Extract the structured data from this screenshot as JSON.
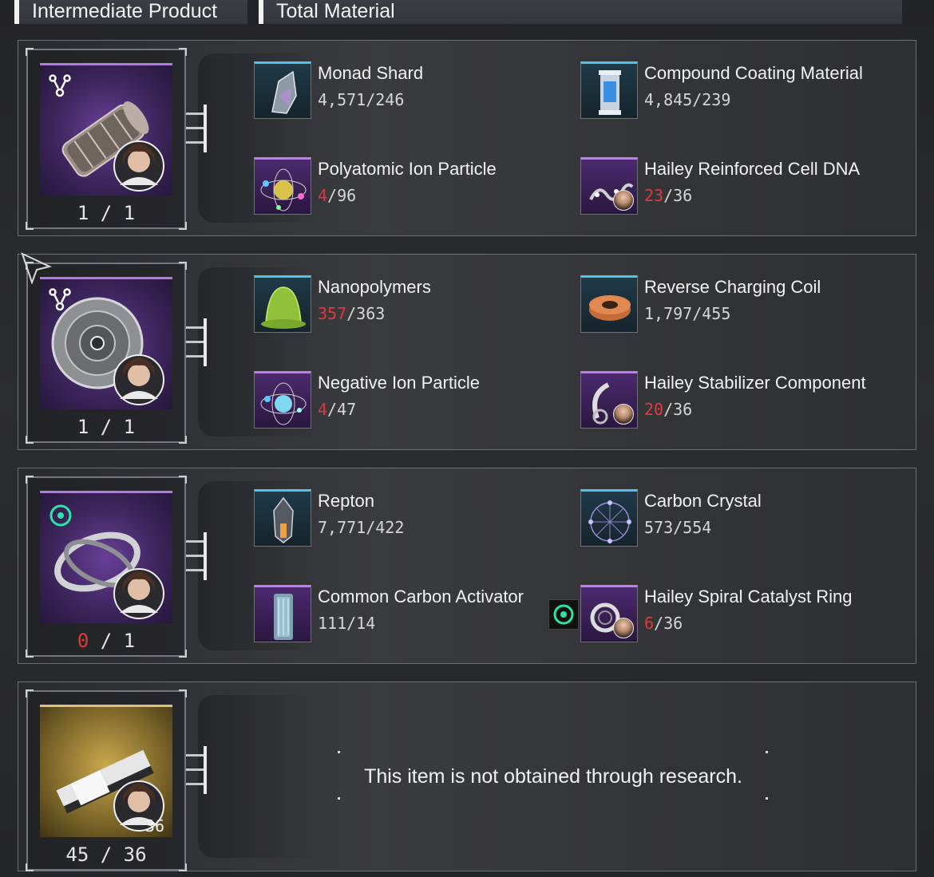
{
  "tabs": {
    "intermediate_product": "Intermediate Product",
    "total_material": "Total Material"
  },
  "rows": [
    {
      "product_count": "1 / 1",
      "materials": [
        {
          "name": "Monad Shard",
          "qty_have": "4,571",
          "qty_need": "246",
          "insufficient": false
        },
        {
          "name": "Compound Coating Material",
          "qty_have": "4,845",
          "qty_need": "239",
          "insufficient": false
        },
        {
          "name": "Polyatomic Ion Particle",
          "qty_have": "4",
          "qty_need": "96",
          "insufficient": true
        },
        {
          "name": "Hailey Reinforced Cell DNA",
          "qty_have": "23",
          "qty_need": "36",
          "insufficient": true
        }
      ]
    },
    {
      "product_count": "1 / 1",
      "materials": [
        {
          "name": "Nanopolymers",
          "qty_have": "357",
          "qty_need": "363",
          "insufficient": true
        },
        {
          "name": "Reverse Charging Coil",
          "qty_have": "1,797",
          "qty_need": "455",
          "insufficient": false
        },
        {
          "name": "Negative Ion Particle",
          "qty_have": "4",
          "qty_need": "47",
          "insufficient": true
        },
        {
          "name": "Hailey Stabilizer Component",
          "qty_have": "20",
          "qty_need": "36",
          "insufficient": true
        }
      ]
    },
    {
      "product_count_have": "0",
      "product_count_need": "1",
      "materials": [
        {
          "name": "Repton",
          "qty_have": "7,771",
          "qty_need": "422",
          "insufficient": false
        },
        {
          "name": "Carbon Crystal",
          "qty_have": "573",
          "qty_need": "554",
          "insufficient": false
        },
        {
          "name": "Common Carbon Activator",
          "qty_have": "111",
          "qty_need": "14",
          "insufficient": false
        },
        {
          "name": "Hailey Spiral Catalyst Ring",
          "qty_have": "6",
          "qty_need": "36",
          "insufficient": true
        }
      ]
    },
    {
      "product_count": "45 / 36",
      "product_badge": "36",
      "message": "This item is not obtained through research."
    }
  ],
  "colors": {
    "insufficient": "#e0393b",
    "rare_border": "#c27cf0",
    "normal_border": "#4fc3e8",
    "location_icon": "#2fe3a8"
  },
  "icons": [
    "research-icon",
    "location-icon",
    "character-avatar",
    "pointer-cursor-icon"
  ]
}
